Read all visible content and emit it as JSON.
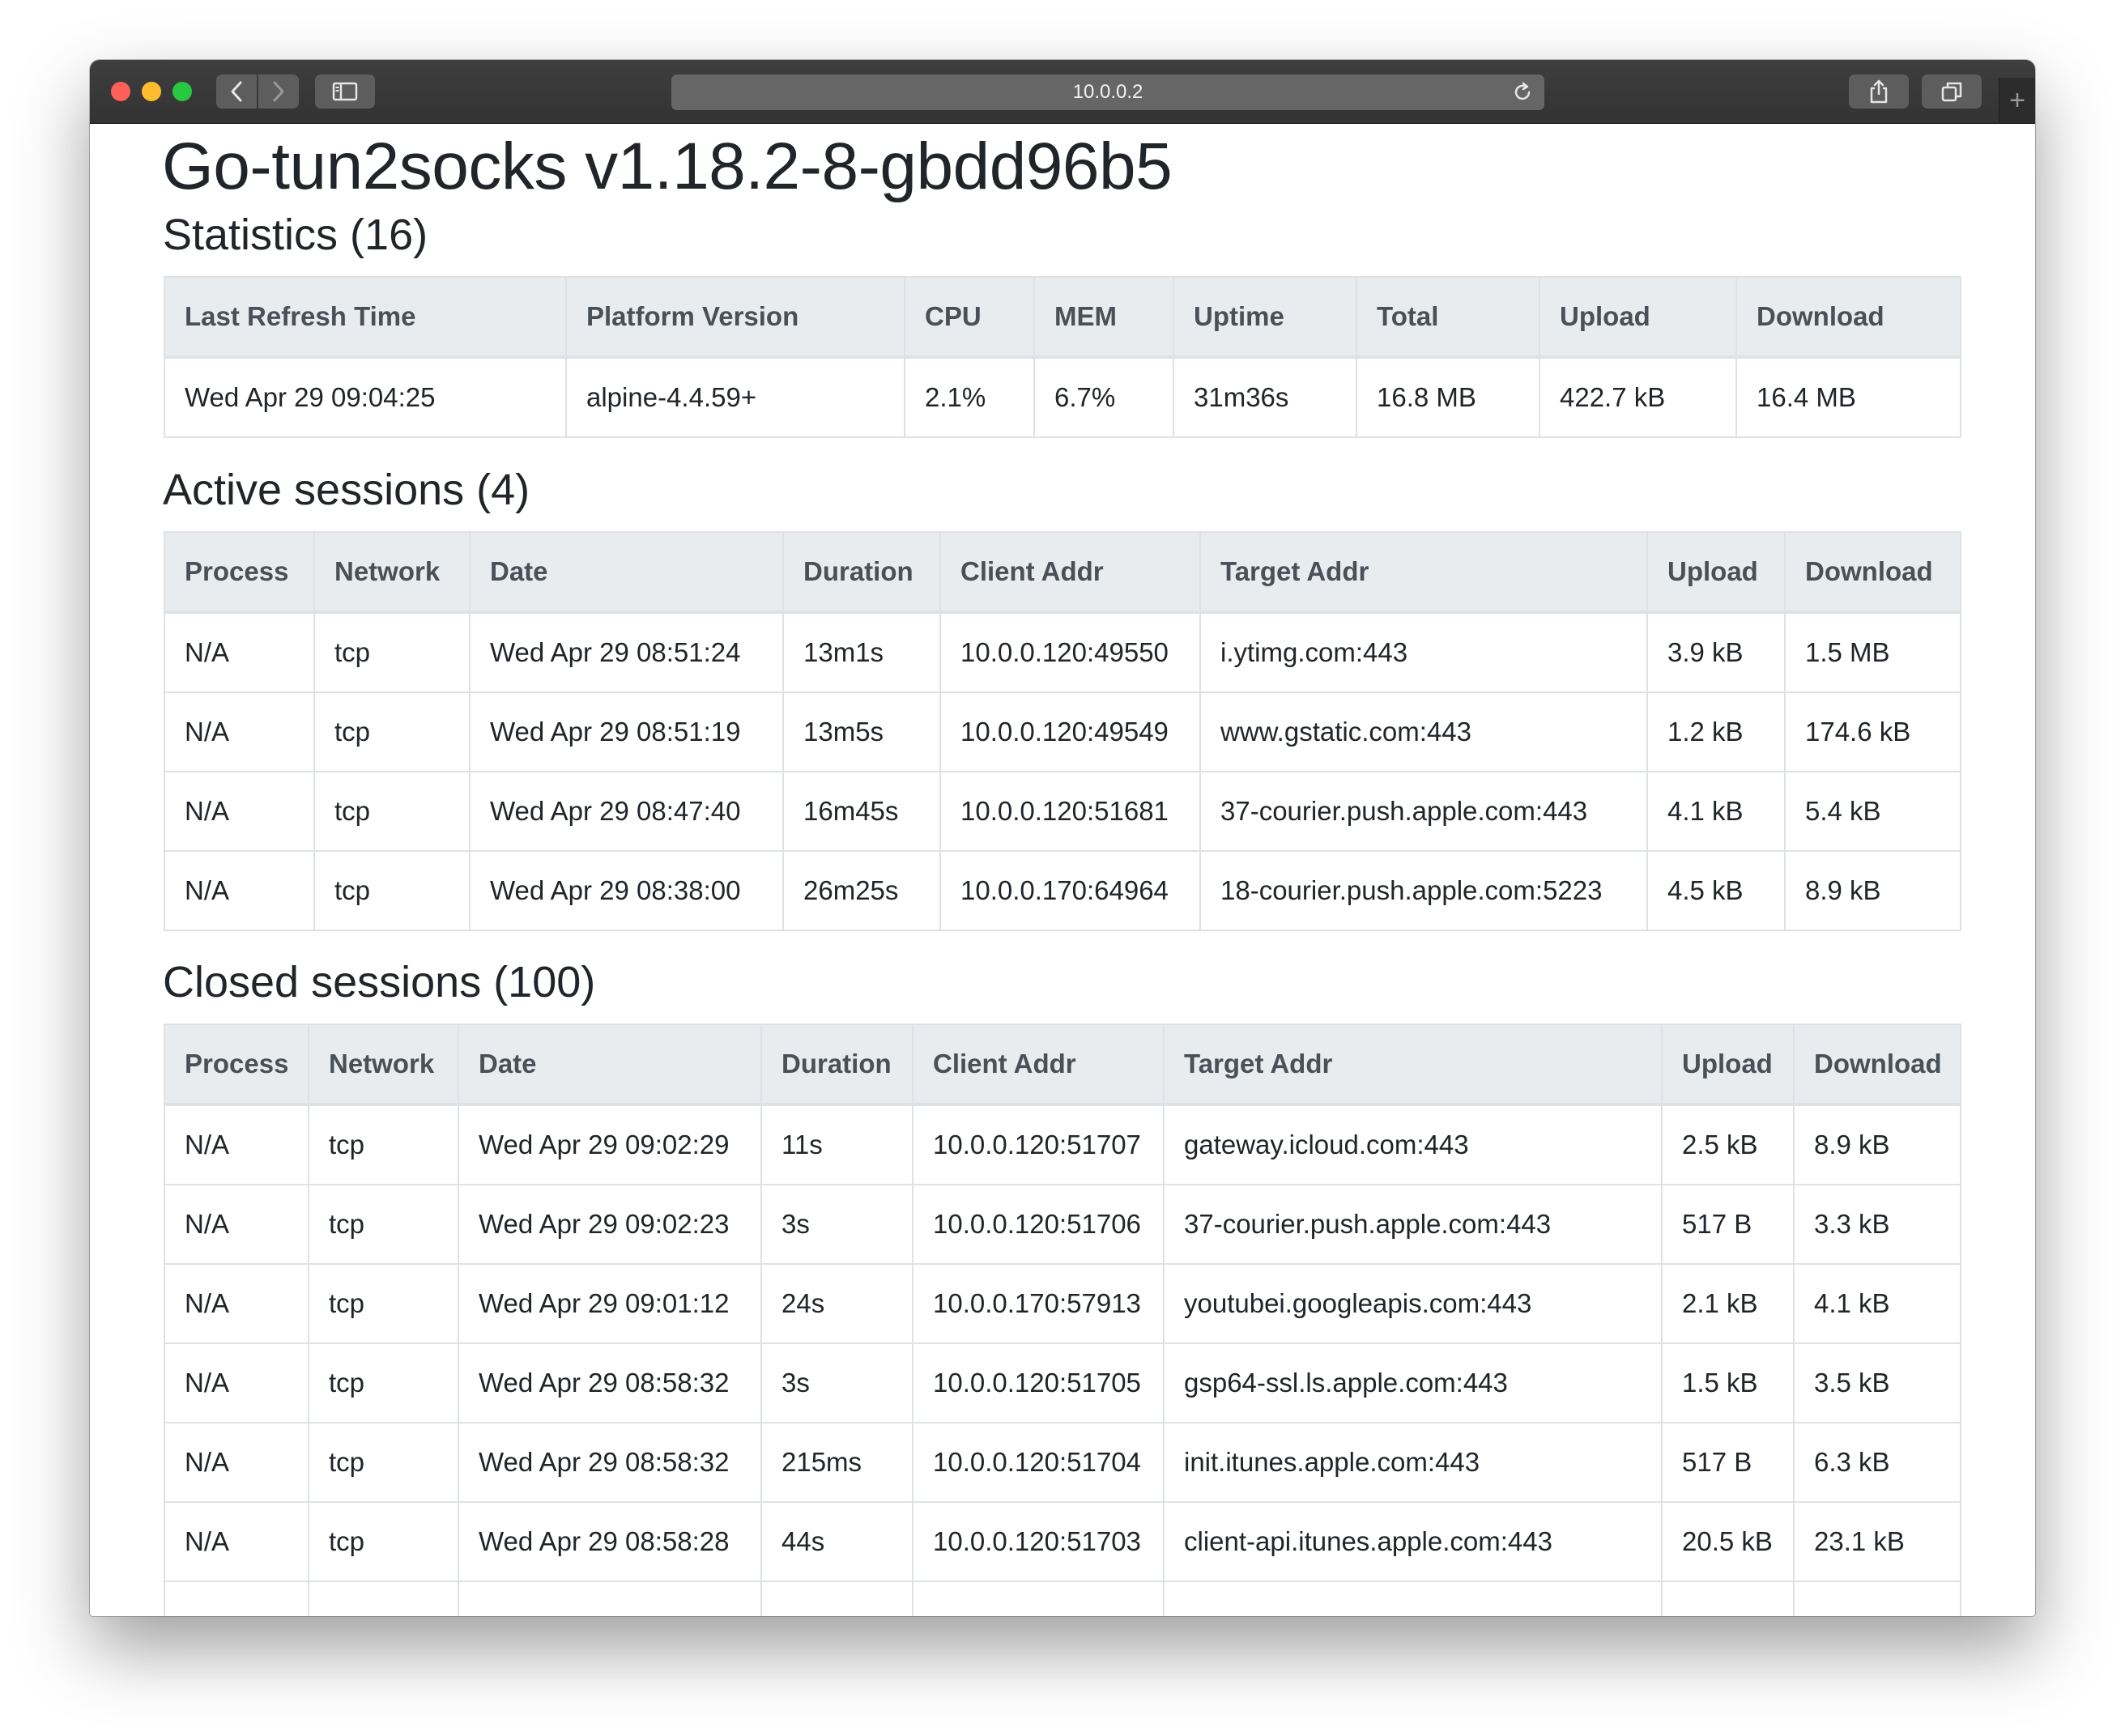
{
  "browser": {
    "url": "10.0.0.2",
    "newtab_label": "+"
  },
  "page": {
    "title": "Go-tun2socks v1.18.2-8-gbdd96b5"
  },
  "statistics": {
    "title": "Statistics (16)",
    "headers": [
      "Last Refresh Time",
      "Platform Version",
      "CPU",
      "MEM",
      "Uptime",
      "Total",
      "Upload",
      "Download"
    ],
    "row": [
      "Wed Apr 29 09:04:25",
      "alpine-4.4.59+",
      "2.1%",
      "6.7%",
      "31m36s",
      "16.8 MB",
      "422.7 kB",
      "16.4 MB"
    ]
  },
  "active": {
    "title": "Active sessions (4)",
    "headers": [
      "Process",
      "Network",
      "Date",
      "Duration",
      "Client Addr",
      "Target Addr",
      "Upload",
      "Download"
    ],
    "rows": [
      [
        "N/A",
        "tcp",
        "Wed Apr 29 08:51:24",
        "13m1s",
        "10.0.0.120:49550",
        "i.ytimg.com:443",
        "3.9 kB",
        "1.5 MB"
      ],
      [
        "N/A",
        "tcp",
        "Wed Apr 29 08:51:19",
        "13m5s",
        "10.0.0.120:49549",
        "www.gstatic.com:443",
        "1.2 kB",
        "174.6 kB"
      ],
      [
        "N/A",
        "tcp",
        "Wed Apr 29 08:47:40",
        "16m45s",
        "10.0.0.120:51681",
        "37-courier.push.apple.com:443",
        "4.1 kB",
        "5.4 kB"
      ],
      [
        "N/A",
        "tcp",
        "Wed Apr 29 08:38:00",
        "26m25s",
        "10.0.0.170:64964",
        "18-courier.push.apple.com:5223",
        "4.5 kB",
        "8.9 kB"
      ]
    ]
  },
  "closed": {
    "title": "Closed sessions (100)",
    "headers": [
      "Process",
      "Network",
      "Date",
      "Duration",
      "Client Addr",
      "Target Addr",
      "Upload",
      "Download"
    ],
    "rows": [
      [
        "N/A",
        "tcp",
        "Wed Apr 29 09:02:29",
        "11s",
        "10.0.0.120:51707",
        "gateway.icloud.com:443",
        "2.5 kB",
        "8.9 kB"
      ],
      [
        "N/A",
        "tcp",
        "Wed Apr 29 09:02:23",
        "3s",
        "10.0.0.120:51706",
        "37-courier.push.apple.com:443",
        "517 B",
        "3.3 kB"
      ],
      [
        "N/A",
        "tcp",
        "Wed Apr 29 09:01:12",
        "24s",
        "10.0.0.170:57913",
        "youtubei.googleapis.com:443",
        "2.1 kB",
        "4.1 kB"
      ],
      [
        "N/A",
        "tcp",
        "Wed Apr 29 08:58:32",
        "3s",
        "10.0.0.120:51705",
        "gsp64-ssl.ls.apple.com:443",
        "1.5 kB",
        "3.5 kB"
      ],
      [
        "N/A",
        "tcp",
        "Wed Apr 29 08:58:32",
        "215ms",
        "10.0.0.120:51704",
        "init.itunes.apple.com:443",
        "517 B",
        "6.3 kB"
      ],
      [
        "N/A",
        "tcp",
        "Wed Apr 29 08:58:28",
        "44s",
        "10.0.0.120:51703",
        "client-api.itunes.apple.com:443",
        "20.5 kB",
        "23.1 kB"
      ],
      [
        "",
        "",
        "",
        "",
        "",
        "",
        "",
        ""
      ]
    ]
  }
}
